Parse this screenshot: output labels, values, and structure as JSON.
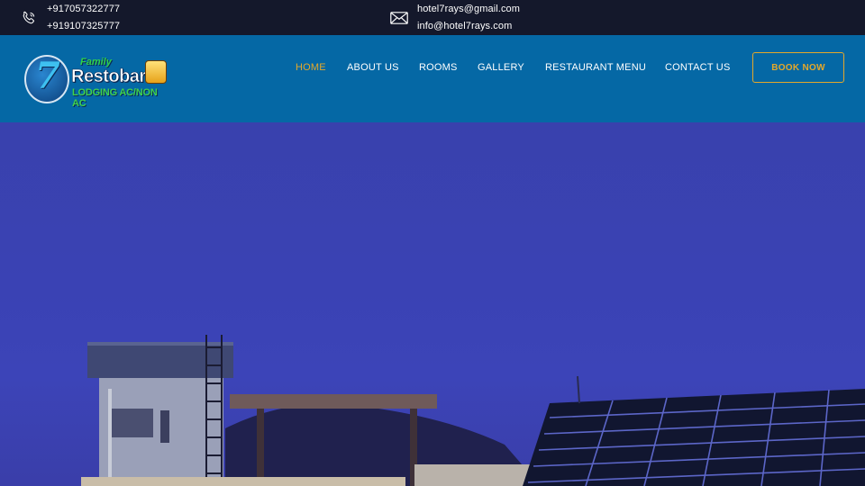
{
  "topbar": {
    "phone": {
      "icon": "phone-icon",
      "lines": [
        "+917057322777",
        "+919107325777"
      ]
    },
    "email": {
      "icon": "envelope-icon",
      "lines": [
        "hotel7rays@gmail.com",
        "info@hotel7rays.com"
      ]
    }
  },
  "logo": {
    "number": "7",
    "family": "Family",
    "name": "Restobar",
    "subtitle": "LODGING AC/NON AC"
  },
  "nav": {
    "items": [
      {
        "label": "HOME",
        "active": true
      },
      {
        "label": "ABOUT US",
        "active": false
      },
      {
        "label": "ROOMS",
        "active": false
      },
      {
        "label": "GALLERY",
        "active": false
      },
      {
        "label": "RESTAURANT MENU",
        "active": false
      },
      {
        "label": "CONTACT US",
        "active": false
      }
    ],
    "book_label": "BOOK NOW"
  },
  "colors": {
    "topbar_bg": "#14182b",
    "header_bg": "#0568a5",
    "accent": "#e4a82a",
    "hero_sky": "#3a42b4"
  }
}
